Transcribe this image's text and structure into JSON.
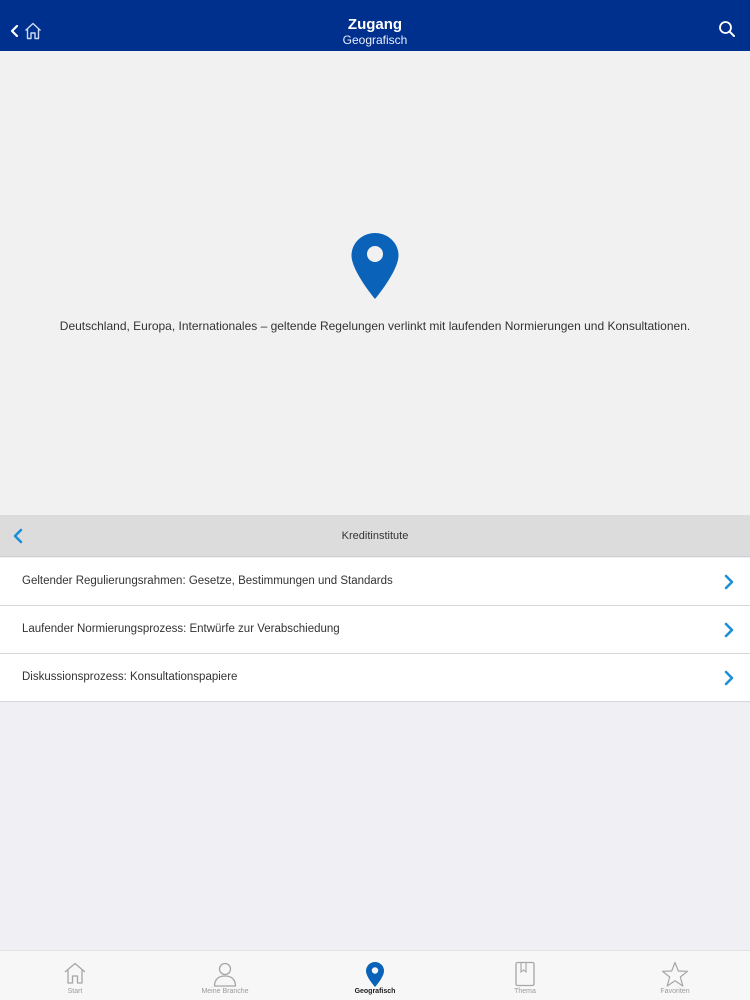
{
  "navbar": {
    "title": "Zugang",
    "subtitle": "Geografisch",
    "back_icon": "chevron-left-icon",
    "home_icon": "home-icon",
    "search_icon": "search-icon"
  },
  "hero": {
    "icon": "location-pin-icon",
    "text": "Deutschland, Europa, Internationales – geltende Regelungen verlinkt mit laufenden Normierungen und Konsultationen."
  },
  "section": {
    "title": "Kreditinstitute"
  },
  "list": {
    "items": [
      {
        "label": "Geltender Regulierungsrahmen: Gesetze, Bestimmungen und Standards"
      },
      {
        "label": "Laufender Normierungsprozess: Entwürfe zur Verabschiedung"
      },
      {
        "label": "Diskussionsprozess: Konsultationspapiere"
      }
    ]
  },
  "tabbar": {
    "tabs": [
      {
        "label": "Start",
        "icon": "home-icon"
      },
      {
        "label": "Meine Branche",
        "icon": "person-icon"
      },
      {
        "label": "Geografisch",
        "icon": "location-pin-icon",
        "active": true
      },
      {
        "label": "Thema",
        "icon": "book-icon"
      },
      {
        "label": "Favoriten",
        "icon": "star-icon"
      }
    ]
  },
  "colors": {
    "navbar": "#00308e",
    "accent": "#0a63b8",
    "chevron": "#1e8fd8"
  }
}
